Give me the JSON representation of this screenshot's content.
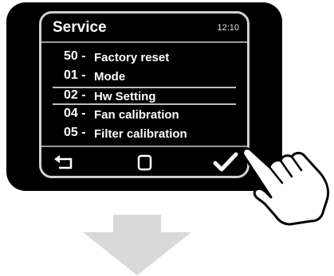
{
  "screen": {
    "title": "Service",
    "clock": "12:10"
  },
  "menu": {
    "items": [
      {
        "code": "50 -",
        "label": "Factory reset",
        "selected": false
      },
      {
        "code": "01 -",
        "label": "Mode",
        "selected": false
      },
      {
        "code": "02 -",
        "label": "Hw Setting",
        "selected": true
      },
      {
        "code": "04 -",
        "label": "Fan calibration",
        "selected": false
      },
      {
        "code": "05 -",
        "label": "Filter calibration",
        "selected": false
      }
    ]
  },
  "nav": {
    "back_icon": "back-arrow-icon",
    "home_icon": "square-icon",
    "ok_icon": "checkmark-icon"
  },
  "colors": {
    "device": "#000000",
    "screen_border": "#d0d0d0",
    "arrow": "#d9d9d9",
    "text": "#ffffff"
  }
}
